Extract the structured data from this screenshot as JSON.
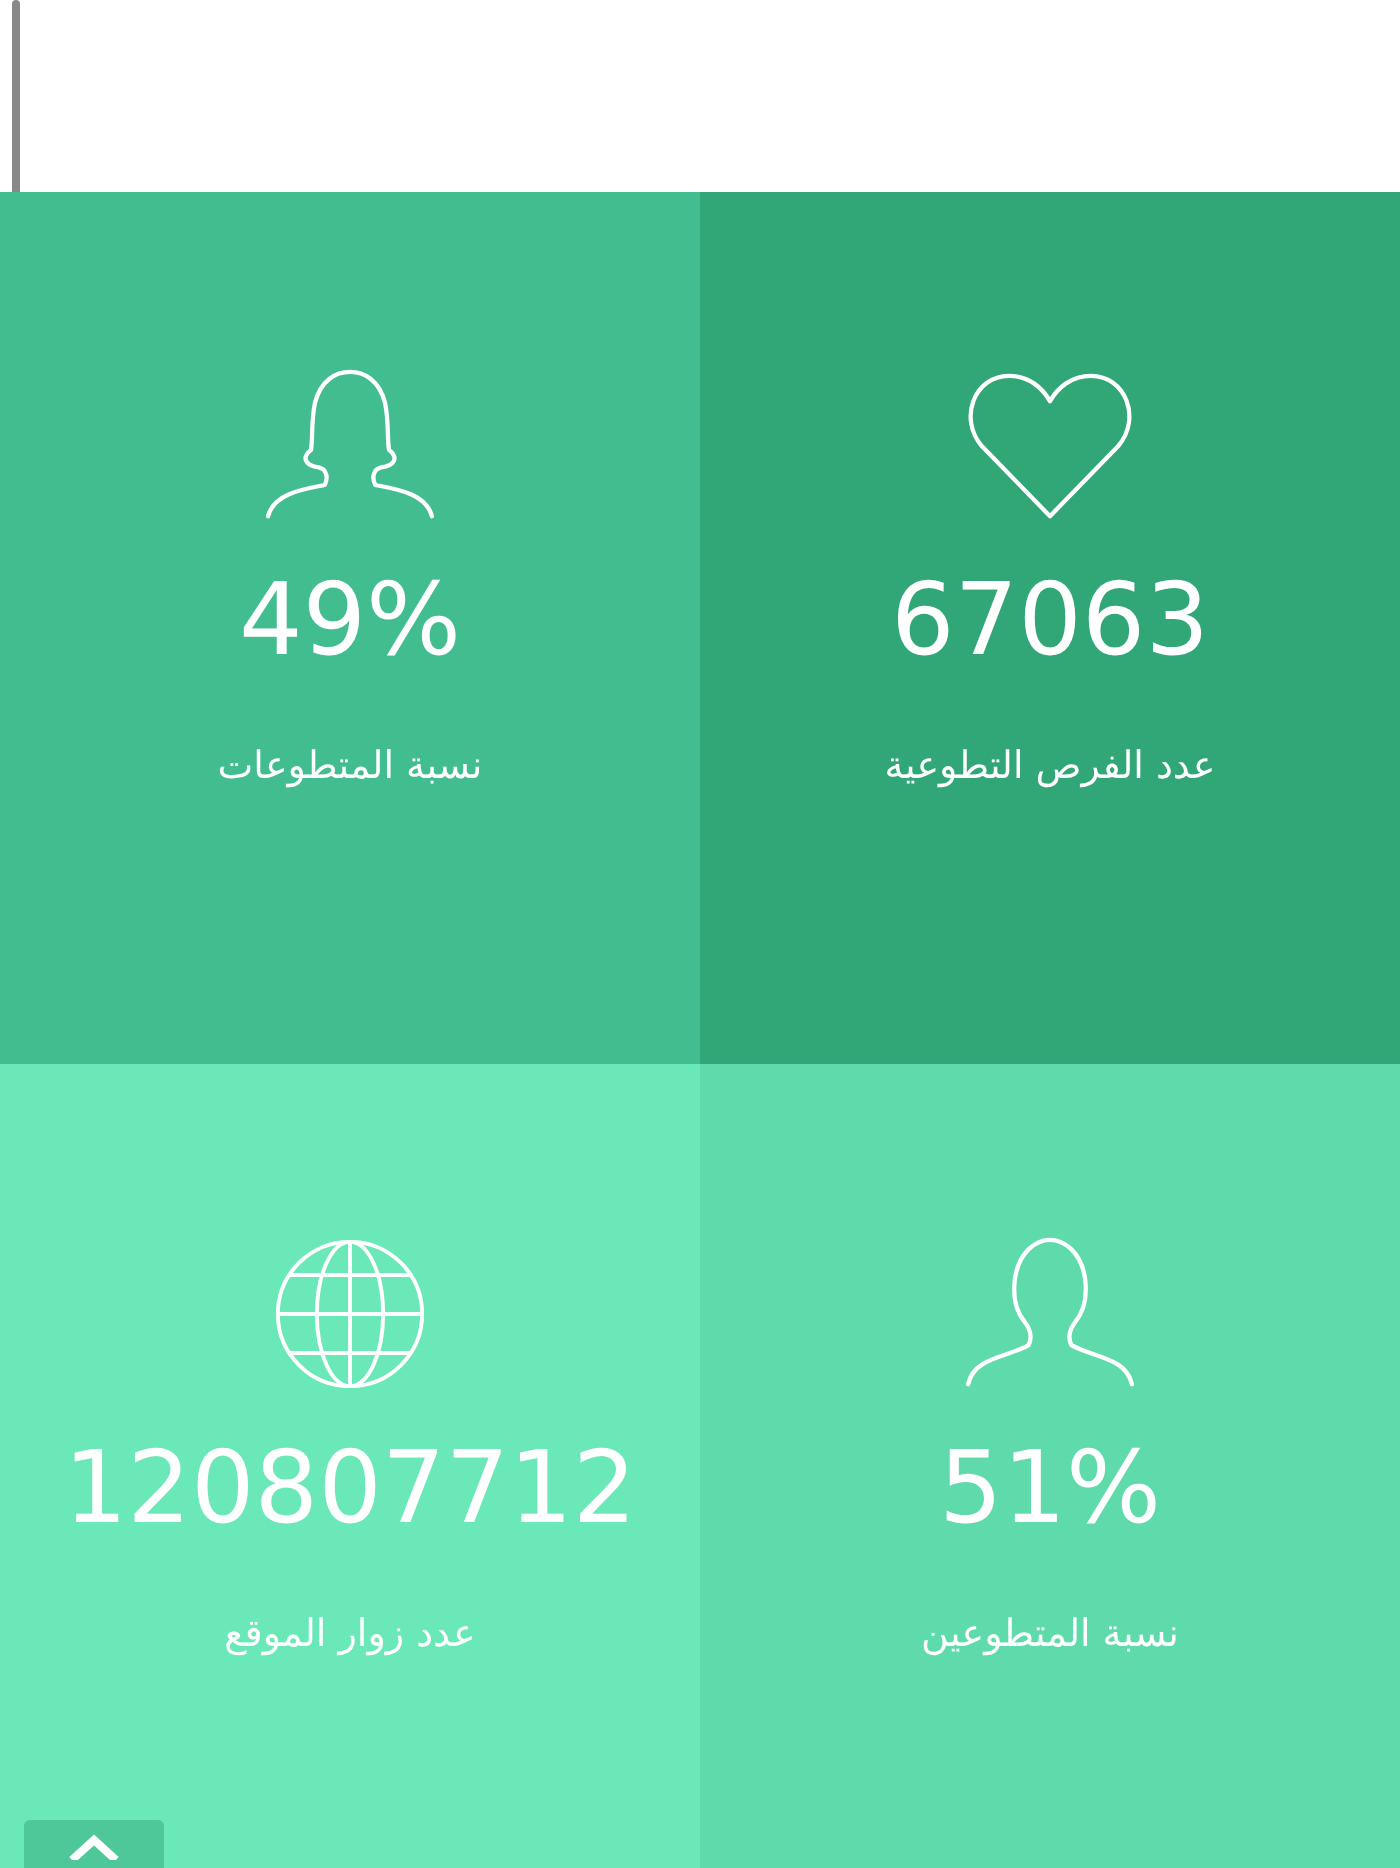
{
  "stats": [
    {
      "kind": "heart",
      "value": "67063",
      "label": "عدد الفرص التطوعية",
      "color": "#31a677"
    },
    {
      "kind": "female",
      "value": "49%",
      "label": "نسبة المتطوعات",
      "color": "#42bd8f"
    },
    {
      "kind": "male",
      "value": "51%",
      "label": "نسبة المتطوعين",
      "color": "#5fdaab"
    },
    {
      "kind": "globe",
      "value": "120807712",
      "label": "عدد زوار الموقع",
      "color": "#6ae8b7"
    }
  ]
}
